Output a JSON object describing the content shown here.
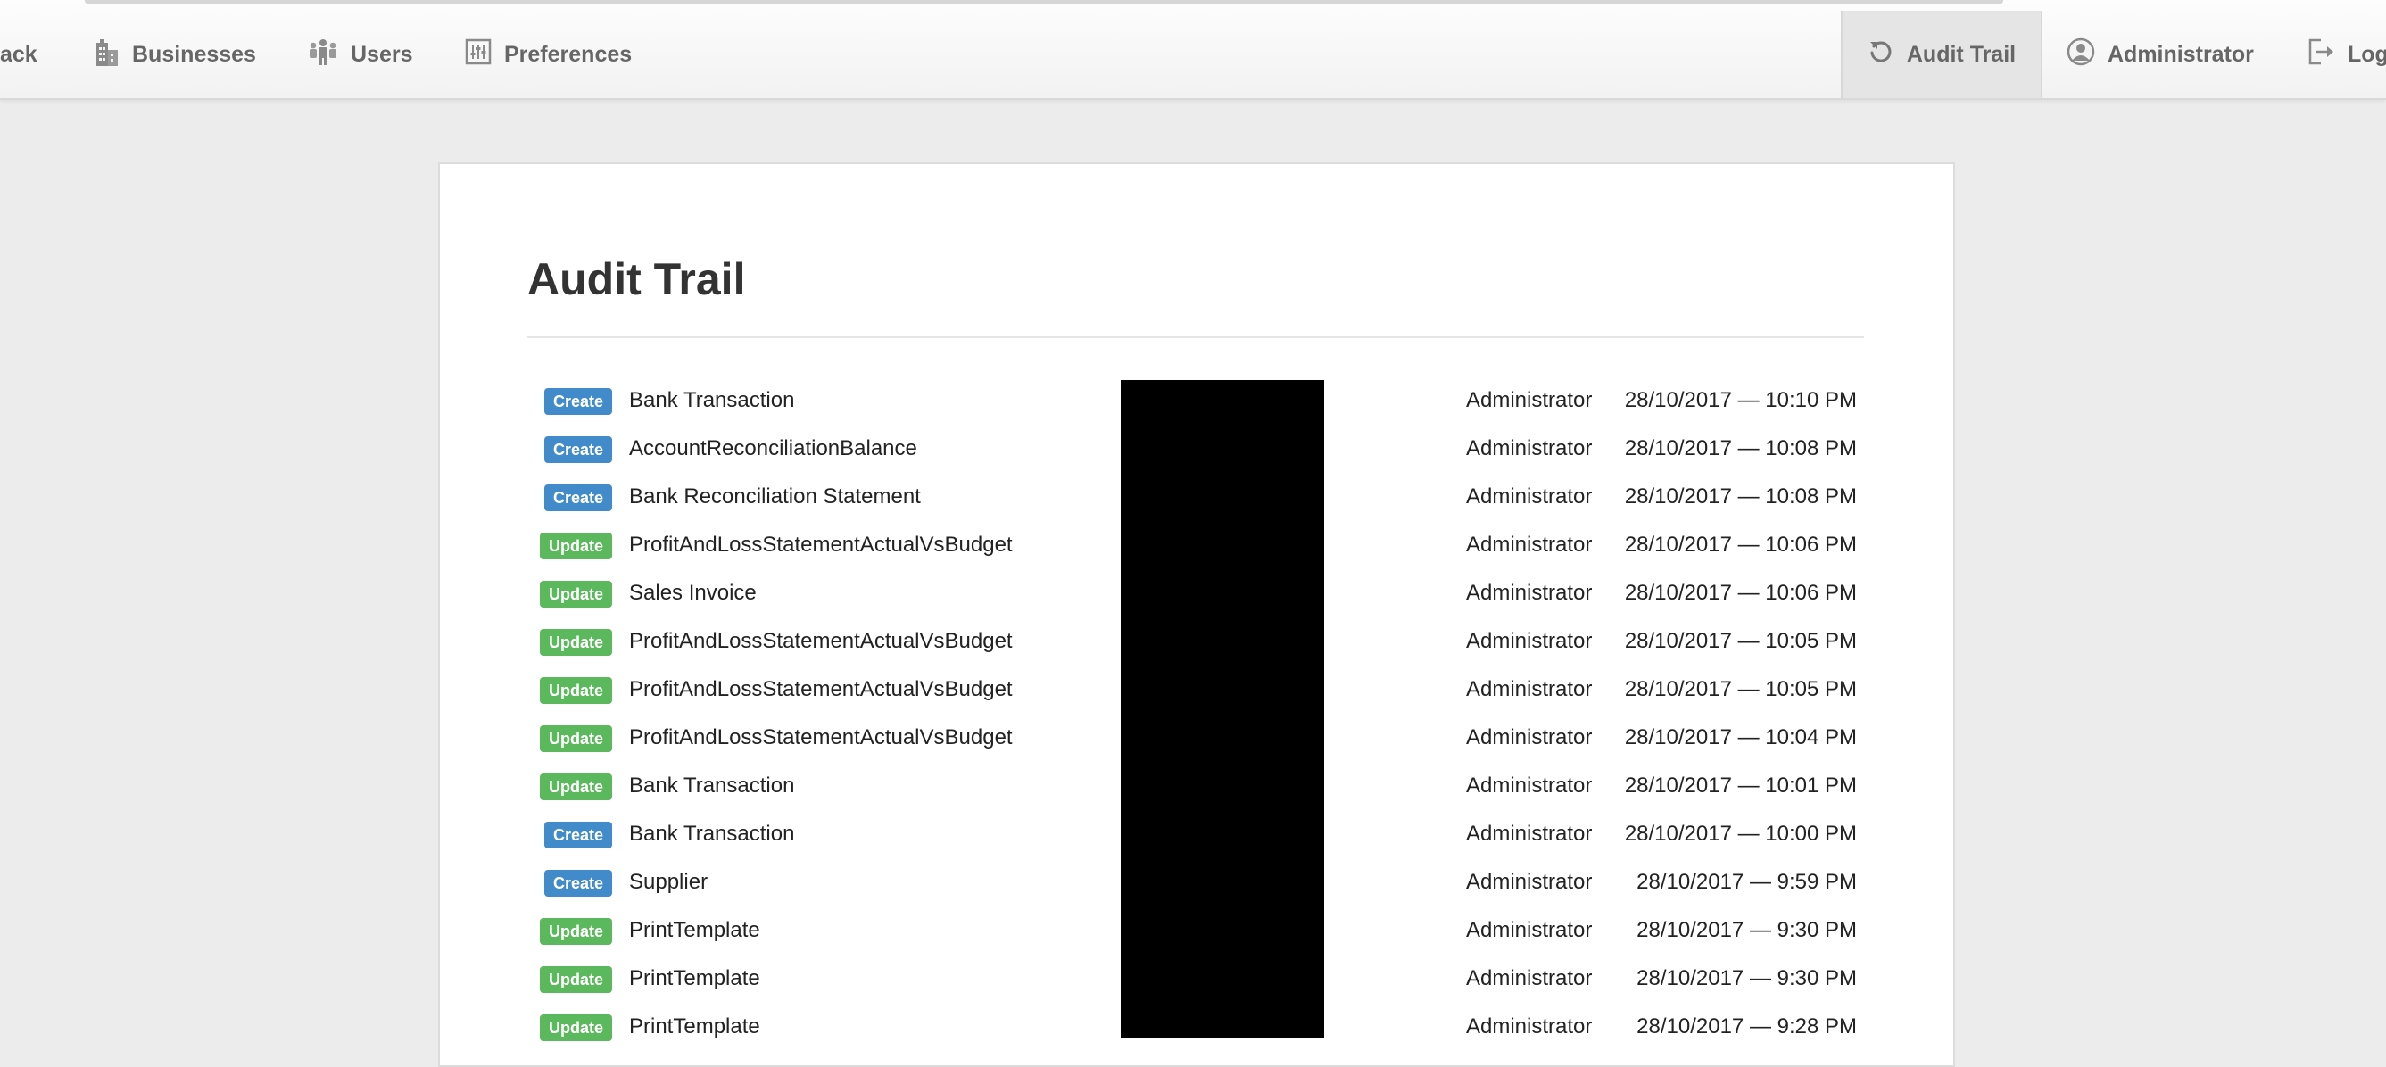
{
  "nav": {
    "back_label": "ack",
    "businesses_label": "Businesses",
    "users_label": "Users",
    "preferences_label": "Preferences",
    "audit_trail_label": "Audit Trail",
    "administrator_label": "Administrator",
    "logout_label": "Log"
  },
  "page": {
    "title": "Audit Trail"
  },
  "colors": {
    "create_badge": "#428bca",
    "update_badge": "#5cb85c"
  },
  "rows": [
    {
      "action": "Create",
      "entity": "Bank Transaction",
      "user": "Administrator",
      "time": "28/10/2017 — 10:10 PM"
    },
    {
      "action": "Create",
      "entity": "AccountReconciliationBalance",
      "user": "Administrator",
      "time": "28/10/2017 — 10:08 PM"
    },
    {
      "action": "Create",
      "entity": "Bank Reconciliation Statement",
      "user": "Administrator",
      "time": "28/10/2017 — 10:08 PM"
    },
    {
      "action": "Update",
      "entity": "ProfitAndLossStatementActualVsBudget",
      "user": "Administrator",
      "time": "28/10/2017 — 10:06 PM"
    },
    {
      "action": "Update",
      "entity": "Sales Invoice",
      "user": "Administrator",
      "time": "28/10/2017 — 10:06 PM"
    },
    {
      "action": "Update",
      "entity": "ProfitAndLossStatementActualVsBudget",
      "user": "Administrator",
      "time": "28/10/2017 — 10:05 PM"
    },
    {
      "action": "Update",
      "entity": "ProfitAndLossStatementActualVsBudget",
      "user": "Administrator",
      "time": "28/10/2017 — 10:05 PM"
    },
    {
      "action": "Update",
      "entity": "ProfitAndLossStatementActualVsBudget",
      "user": "Administrator",
      "time": "28/10/2017 — 10:04 PM"
    },
    {
      "action": "Update",
      "entity": "Bank Transaction",
      "user": "Administrator",
      "time": "28/10/2017 — 10:01 PM"
    },
    {
      "action": "Create",
      "entity": "Bank Transaction",
      "user": "Administrator",
      "time": "28/10/2017 — 10:00 PM"
    },
    {
      "action": "Create",
      "entity": "Supplier",
      "user": "Administrator",
      "time": "28/10/2017 — 9:59 PM"
    },
    {
      "action": "Update",
      "entity": "PrintTemplate",
      "user": "Administrator",
      "time": "28/10/2017 — 9:30 PM"
    },
    {
      "action": "Update",
      "entity": "PrintTemplate",
      "user": "Administrator",
      "time": "28/10/2017 — 9:30 PM"
    },
    {
      "action": "Update",
      "entity": "PrintTemplate",
      "user": "Administrator",
      "time": "28/10/2017 — 9:28 PM"
    }
  ]
}
